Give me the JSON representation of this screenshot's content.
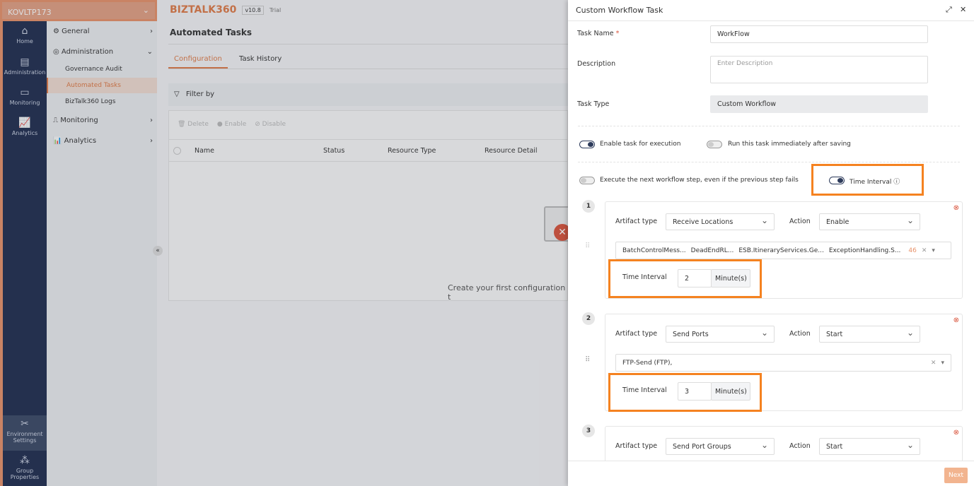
{
  "env": {
    "name": "KOVLTP173"
  },
  "rail": [
    {
      "label": "Home",
      "icon": "home-icon"
    },
    {
      "label": "Administration",
      "icon": "server-gear-icon"
    },
    {
      "label": "Monitoring",
      "icon": "monitor-icon"
    },
    {
      "label": "Analytics",
      "icon": "analytics-icon"
    },
    {
      "label": "Environment Settings",
      "icon": "tools-icon"
    },
    {
      "label": "Group Properties",
      "icon": "cubes-icon"
    }
  ],
  "subnav": {
    "general": "General",
    "administration": "Administration",
    "items": [
      "Governance Audit",
      "Automated Tasks",
      "BizTalk360 Logs"
    ],
    "monitoring": "Monitoring",
    "analytics": "Analytics"
  },
  "header": {
    "logo": "BIZTALK360",
    "version": "v10.8",
    "edition": "Trial"
  },
  "main": {
    "title": "Automated Tasks",
    "tabs": [
      "Configuration",
      "Task History"
    ],
    "filter": "Filter by",
    "actions": [
      "Delete",
      "Enable",
      "Disable"
    ],
    "columns": [
      "Name",
      "Status",
      "Resource Type",
      "Resource Detail"
    ],
    "empty": "Create your first configuration t"
  },
  "panel": {
    "title": "Custom Workflow Task",
    "task_name_label": "Task Name",
    "required": "*",
    "task_name": "WorkFlow",
    "description_label": "Description",
    "description_placeholder": "Enter Description",
    "task_type_label": "Task Type",
    "task_type": "Custom Workflow",
    "enable_label": "Enable task for execution",
    "enable_on": true,
    "run_now_label": "Run this task immediately after saving",
    "run_now_on": false,
    "continue_label": "Execute the next workflow step, even if the previous step fails",
    "continue_on": false,
    "time_interval_label": "Time Interval",
    "time_interval_on": true,
    "steps": [
      {
        "num": "1",
        "artifact_label": "Artifact type",
        "artifact": "Receive Locations",
        "action_label": "Action",
        "action": "Enable",
        "items": [
          "BatchControlMess...",
          "DeadEndRL...",
          "ESB.ItineraryServices.Ge...",
          "ExceptionHandling.S..."
        ],
        "more": "46",
        "ti_label": "Time Interval",
        "ti": "2",
        "unit": "Minute(s)"
      },
      {
        "num": "2",
        "artifact_label": "Artifact type",
        "artifact": "Send Ports",
        "action_label": "Action",
        "action": "Start",
        "items": [
          "FTP-Send (FTP),"
        ],
        "ti_label": "Time Interval",
        "ti": "3",
        "unit": "Minute(s)"
      },
      {
        "num": "3",
        "artifact_label": "Artifact type",
        "artifact": "Send Port Groups",
        "action_label": "Action",
        "action": "Start"
      }
    ],
    "next": "Next"
  },
  "colors": {
    "accent": "#e07b47",
    "highlight": "#f58220",
    "navy": "#1f2d4f"
  }
}
